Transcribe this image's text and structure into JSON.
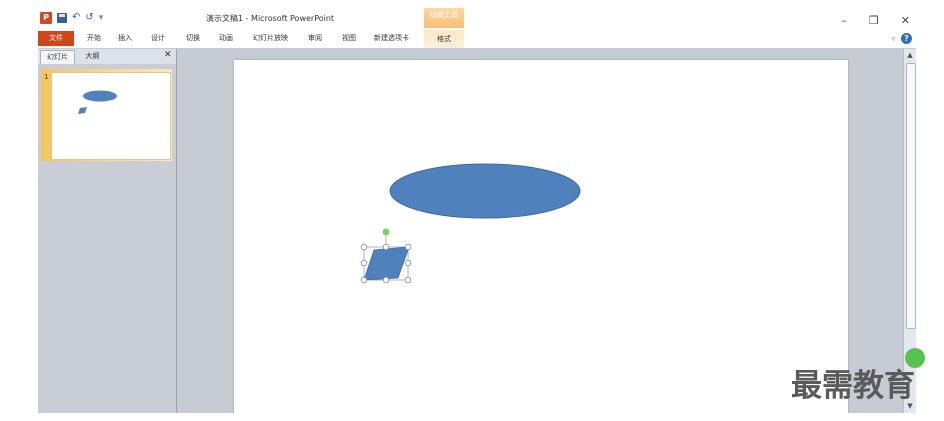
{
  "titlebar": {
    "title": "演示文稿1 - Microsoft PowerPoint",
    "context_group": "绘图工具",
    "minimize": "–",
    "restore": "❐",
    "close": "✕"
  },
  "quick_access": {
    "app_icon": "powerpoint-icon",
    "logo_letter": "P",
    "undo": "↶",
    "redo": "↺",
    "customize": "▾"
  },
  "ribbon": {
    "file_tab": "文件",
    "tabs": [
      "开始",
      "插入",
      "设计",
      "切换",
      "动画",
      "幻灯片放映",
      "审阅",
      "视图",
      "新建选项卡"
    ],
    "context_tab": "格式",
    "collapse": "▿",
    "help": "?"
  },
  "pane": {
    "tab_slides": "幻灯片",
    "tab_outline": "大纲",
    "close": "✕",
    "thumb_number": "1"
  },
  "shapes": {
    "ellipse_fill": "#4f81bd",
    "ellipse_stroke": "#3e6aa0",
    "parallelogram_fill": "#4f81bd",
    "rotation_handle_color": "#7cd35b"
  },
  "scrollbar": {
    "up": "▲",
    "down": "▼"
  },
  "watermark": "最需教育"
}
